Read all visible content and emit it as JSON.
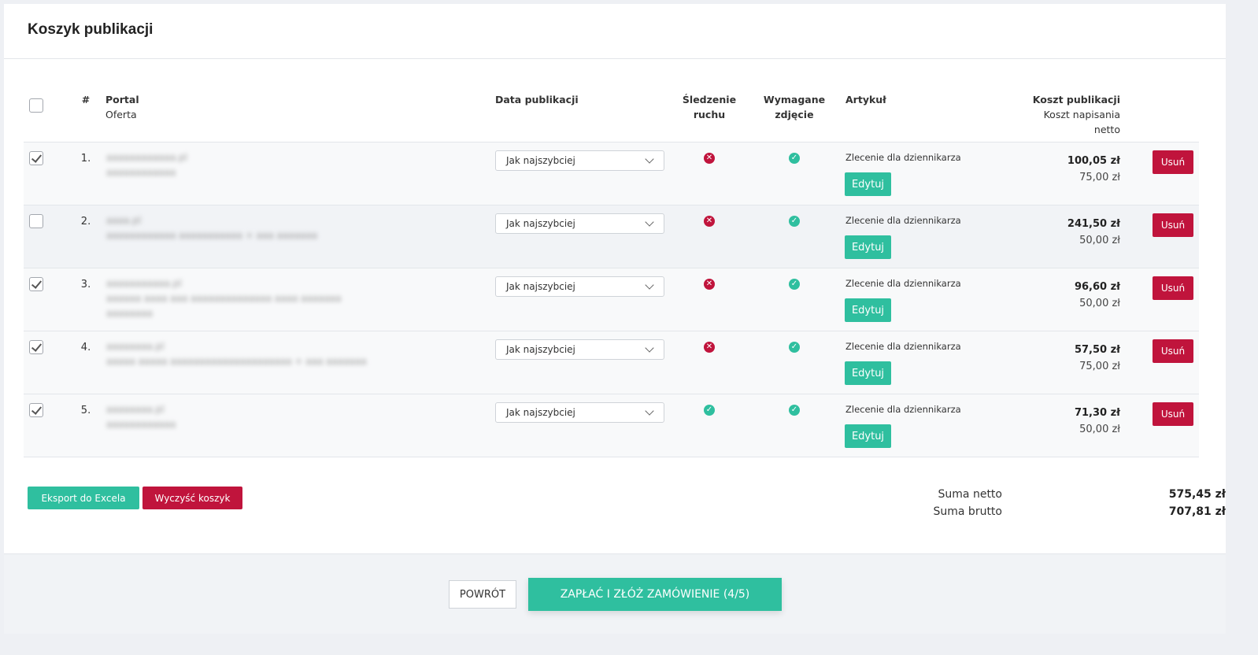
{
  "header": {
    "title": "Koszyk publikacji"
  },
  "table": {
    "headers": {
      "num": "#",
      "portal": "Portal",
      "offer": "Oferta",
      "date": "Data publikacji",
      "tracking_line1": "Śledzenie",
      "tracking_line2": "ruchu",
      "photo_line1": "Wymagane",
      "photo_line2": "zdjęcie",
      "article": "Artykuł",
      "cost_pub": "Koszt publikacji",
      "cost_write_line1": "Koszt napisania",
      "cost_write_line2": "netto"
    },
    "rows": [
      {
        "num": "1.",
        "checked": true,
        "portal_blurred": "aaaaaaaaaaaa.pl",
        "offer_blurred": "aaaaaaaaaaaa",
        "date": "Jak najszybciej",
        "tracking": "no",
        "photo": "ok",
        "article": "Zlecenie dla dziennikarza",
        "edit": "Edytuj",
        "price": "100,05 zł",
        "write_price": "75,00 zł",
        "delete": "Usuń"
      },
      {
        "num": "2.",
        "checked": false,
        "portal_blurred": "aaaa.pl",
        "offer_blurred": "aaaaaaaaaaaa aaaaaaaaaaa + aaa aaaaaaa",
        "date": "Jak najszybciej",
        "tracking": "no",
        "photo": "ok",
        "article": "Zlecenie dla dziennikarza",
        "edit": "Edytuj",
        "price": "241,50 zł",
        "write_price": "50,00 zł",
        "delete": "Usuń"
      },
      {
        "num": "3.",
        "checked": true,
        "portal_blurred": "aaaaaaaaaaa.pl",
        "offer_blurred": "aaaaaa aaaa aaa aaaaaaaaaaaaaa aaaa aaaaaaa aaaaaaaa",
        "date": "Jak najszybciej",
        "tracking": "no",
        "photo": "ok",
        "article": "Zlecenie dla dziennikarza",
        "edit": "Edytuj",
        "price": "96,60 zł",
        "write_price": "50,00 zł",
        "delete": "Usuń"
      },
      {
        "num": "4.",
        "checked": true,
        "portal_blurred": "aaaaaaaa.pl",
        "offer_blurred": "aaaaa aaaaa aaaaaaaaaaaaaaaaaaaaa + aaa aaaaaaa",
        "date": "Jak najszybciej",
        "tracking": "no",
        "photo": "ok",
        "article": "Zlecenie dla dziennikarza",
        "edit": "Edytuj",
        "price": "57,50 zł",
        "write_price": "75,00 zł",
        "delete": "Usuń"
      },
      {
        "num": "5.",
        "checked": true,
        "portal_blurred": "aaaaaaaa.pl",
        "offer_blurred": "aaaaaaaaaaaa",
        "date": "Jak najszybciej",
        "tracking": "ok",
        "photo": "ok",
        "article": "Zlecenie dla dziennikarza",
        "edit": "Edytuj",
        "price": "71,30 zł",
        "write_price": "50,00 zł",
        "delete": "Usuń"
      }
    ]
  },
  "actions": {
    "export": "Eksport do Excela",
    "clear": "Wyczyść koszyk"
  },
  "summary": {
    "net_label": "Suma netto",
    "net_value": "575,45 zł",
    "gross_label": "Suma brutto",
    "gross_value": "707,81 zł"
  },
  "footer": {
    "back": "POWRÓT",
    "pay": "ZAPŁAĆ I ZŁÓŻ ZAMÓWIENIE (4/5)"
  },
  "colors": {
    "accent": "#2fbf9f",
    "danger": "#c0143c"
  },
  "icons": {
    "no": "x-circle-icon",
    "ok": "check-circle-icon"
  }
}
